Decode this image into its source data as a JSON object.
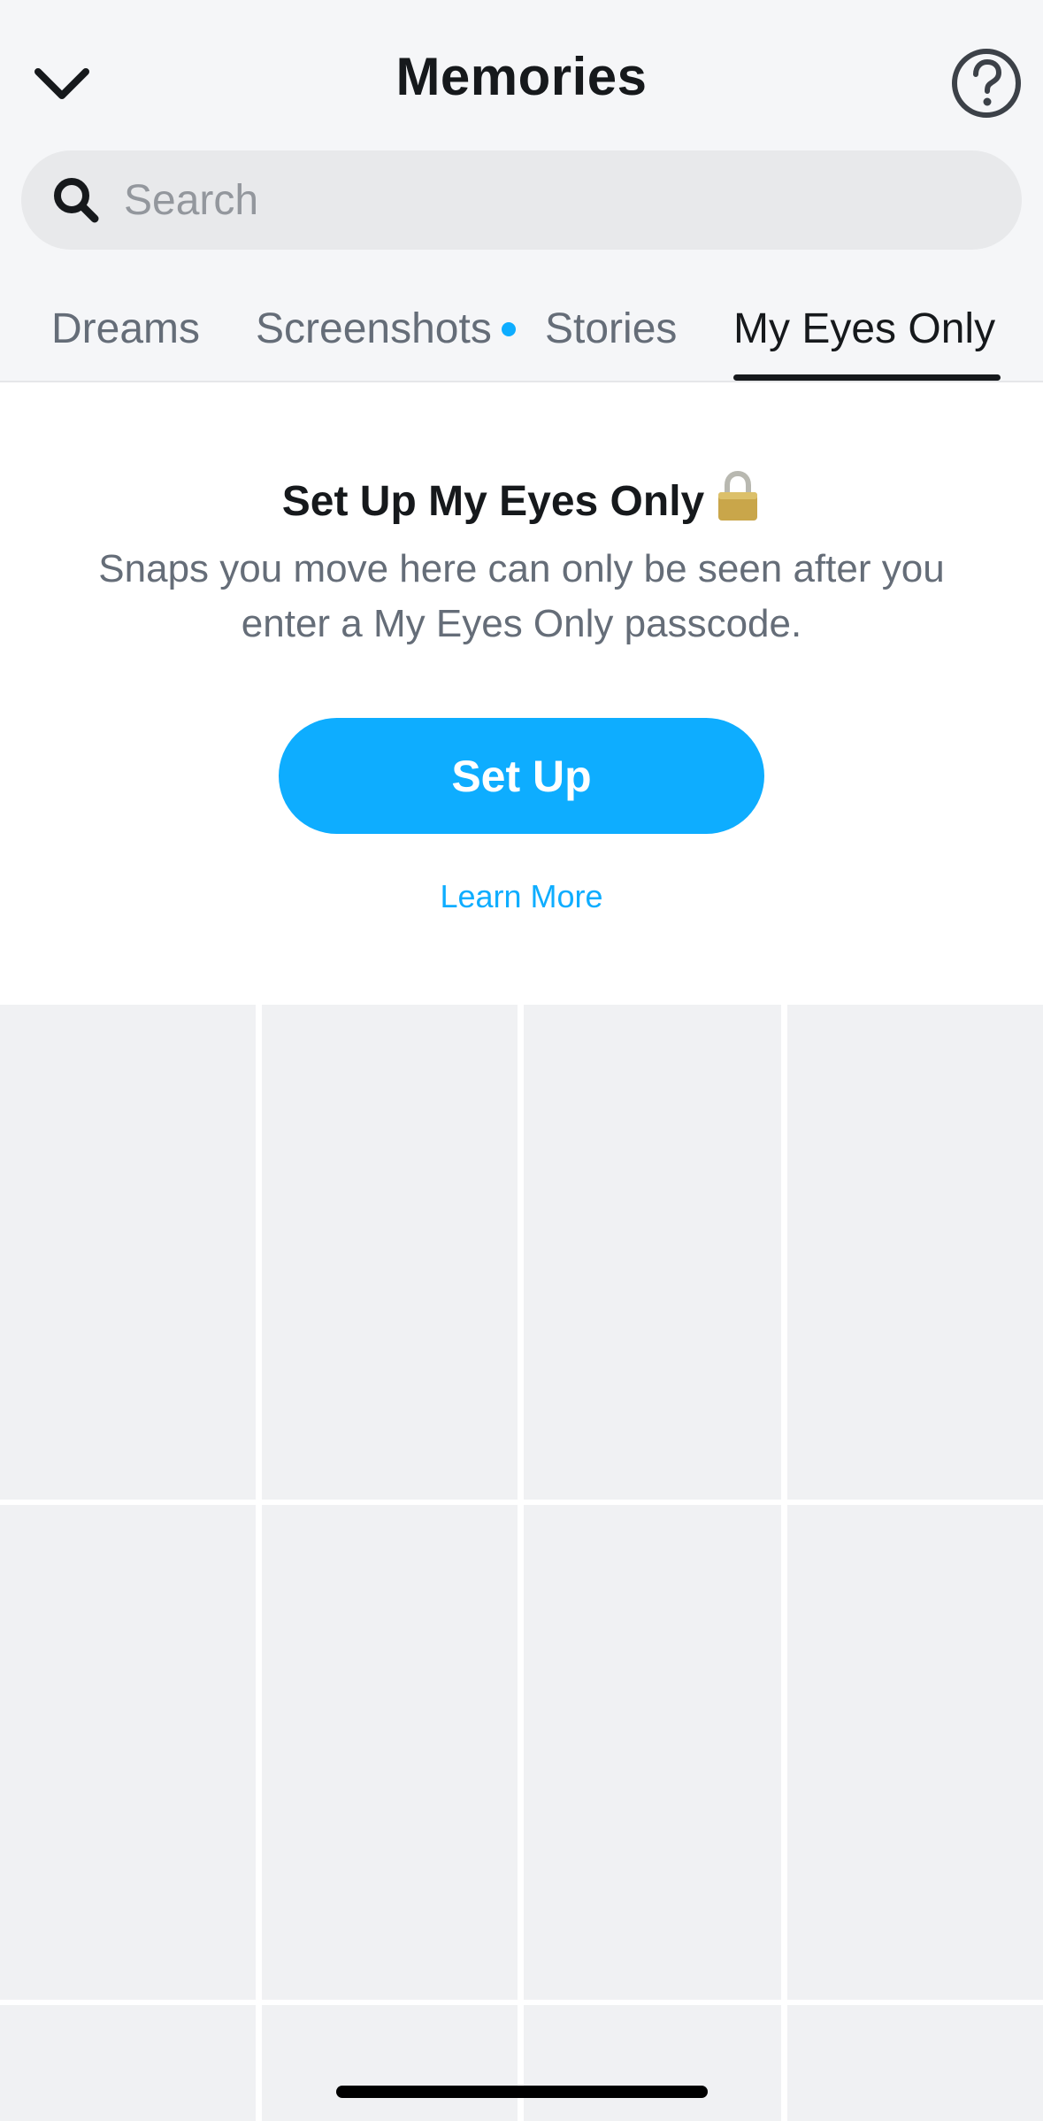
{
  "header": {
    "title": "Memories",
    "back_icon": "chevron-down-icon",
    "help_icon": "question-circle-icon"
  },
  "search": {
    "placeholder": "Search",
    "value": "",
    "icon": "search-icon"
  },
  "tabs": [
    {
      "label": "Dreams",
      "active": false,
      "indicator": false
    },
    {
      "label": "Screenshots",
      "active": false,
      "indicator": true
    },
    {
      "label": "Stories",
      "active": false,
      "indicator": false
    },
    {
      "label": "My Eyes Only",
      "active": true,
      "indicator": false
    }
  ],
  "setup": {
    "title": "Set Up My Eyes Only",
    "title_icon": "lock-icon",
    "description": "Snaps you move here can only be seen after you enter a My Eyes Only passcode.",
    "button_label": "Set Up",
    "link_label": "Learn More"
  },
  "colors": {
    "accent": "#0eadff",
    "text_primary": "#16191c",
    "text_secondary": "#656d78",
    "placeholder": "#93979d",
    "tile": "#f0f1f3"
  }
}
